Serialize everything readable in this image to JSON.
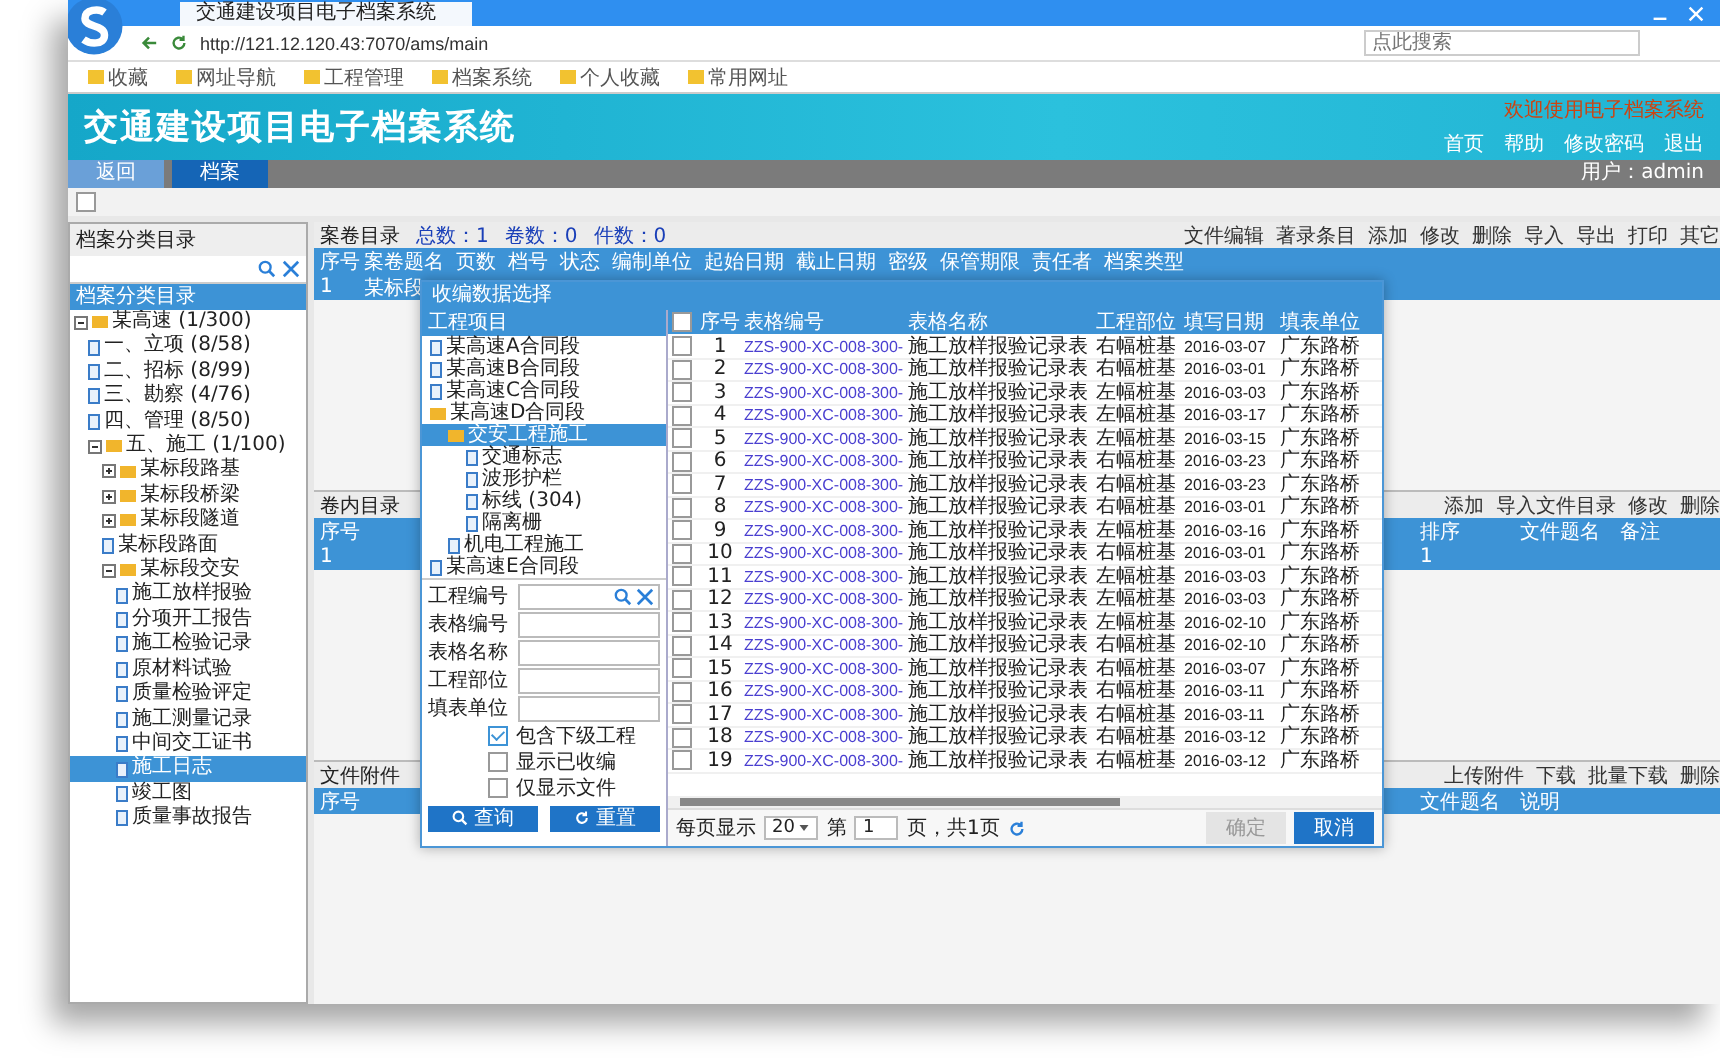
{
  "browser": {
    "tab_title": "交通建设项目电子档案系统",
    "url": "http://121.12.120.43:7070/ams/main",
    "search_placeholder": "点此搜索",
    "bookmarks": [
      "收藏",
      "网址导航",
      "工程管理",
      "档案系统",
      "个人收藏",
      "常用网址"
    ]
  },
  "header": {
    "title": "交通建设项目电子档案系统",
    "notice": "欢迎使用电子档案系统",
    "links": [
      "首页",
      "帮助",
      "修改密码",
      "退出"
    ]
  },
  "tabs": [
    {
      "label": "返回",
      "selected": false
    },
    {
      "label": "档案",
      "selected": true
    }
  ],
  "user": "用户：admin",
  "toolbar_checkbox": {
    "checked": false
  },
  "tree_panel": {
    "title": "档案分类目录",
    "header": "档案分类目录",
    "items": [
      {
        "label": "某高速 (1/300)",
        "selected": false,
        "expanded": true,
        "children": [
          {
            "label": "一、立项 (8/58)",
            "selected": false
          },
          {
            "label": "二、招标 (8/99)",
            "selected": false
          },
          {
            "label": "三、勘察 (4/76)",
            "selected": false
          },
          {
            "label": "四、管理 (8/50)",
            "selected": false
          },
          {
            "label": "五、施工 (1/100)",
            "selected": false,
            "expanded": true,
            "children": [
              {
                "label": "某标段路基",
                "selected": false,
                "expanded": false
              },
              {
                "label": "某标段桥梁",
                "selected": false,
                "expanded": false
              },
              {
                "label": "某标段隧道",
                "selected": false,
                "expanded": false
              },
              {
                "label": "某标段路面",
                "selected": false
              },
              {
                "label": "某标段交安",
                "selected": false,
                "expanded": true,
                "children": [
                  {
                    "label": "施工放样报验",
                    "selected": false
                  },
                  {
                    "label": "分项开工报告",
                    "selected": false
                  },
                  {
                    "label": "施工检验记录",
                    "selected": false
                  },
                  {
                    "label": "原材料试验",
                    "selected": false
                  },
                  {
                    "label": "质量检验评定",
                    "selected": false
                  },
                  {
                    "label": "施工测量记录",
                    "selected": false
                  },
                  {
                    "label": "中间交工证书",
                    "selected": false
                  },
                  {
                    "label": "施工日志",
                    "selected": true
                  },
                  {
                    "label": "竣工图",
                    "selected": false
                  },
                  {
                    "label": "质量事故报告",
                    "selected": false
                  }
                ]
              }
            ]
          }
        ]
      }
    ]
  },
  "main_grid": {
    "title": "案卷目录",
    "counts": [
      "总数：1",
      "卷数：0",
      "件数：0"
    ],
    "toolbar": [
      "文件编辑",
      "著录条目",
      "添加",
      "修改",
      "删除",
      "导入",
      "导出",
      "打印",
      "其它"
    ],
    "columns": [
      "序号",
      "案卷题名",
      "页数",
      "档号",
      "状态",
      "编制单位",
      "起始日期",
      "截止日期",
      "密级",
      "保管期限",
      "责任者",
      "档案类型"
    ],
    "rows": [
      {
        "index": "1",
        "title": "某标段"
      }
    ]
  },
  "inner_grid": {
    "title": "卷内目录",
    "toolbar": [
      "添加",
      "导入文件目录",
      "修改",
      "删除"
    ],
    "columns": [
      "序号",
      "排序",
      "文件题名",
      "备注"
    ],
    "rows": [
      {
        "index": "1",
        "order": "1"
      }
    ]
  },
  "attach_grid": {
    "title": "文件附件",
    "toolbar": [
      "上传附件",
      "下载",
      "批量下载",
      "删除"
    ],
    "columns": [
      "序号",
      "文件题名",
      "说明"
    ]
  },
  "dialog": {
    "title": "收编数据选择",
    "tree_header": "工程项目",
    "tree": [
      {
        "label": "某高速A合同段",
        "selected": false,
        "kind": "file"
      },
      {
        "label": "某高速B合同段",
        "selected": false,
        "kind": "file"
      },
      {
        "label": "某高速C合同段",
        "selected": false,
        "kind": "file"
      },
      {
        "label": "某高速D合同段",
        "selected": false,
        "kind": "folder",
        "children": [
          {
            "label": "交安工程施工",
            "selected": true,
            "kind": "folder",
            "children": [
              {
                "label": "交通标志",
                "selected": false,
                "kind": "file"
              },
              {
                "label": "波形护栏",
                "selected": false,
                "kind": "file"
              },
              {
                "label": "标线 (304)",
                "selected": false,
                "kind": "file"
              },
              {
                "label": "隔离栅",
                "selected": false,
                "kind": "file"
              }
            ]
          },
          {
            "label": "机电工程施工",
            "selected": false,
            "kind": "file"
          }
        ]
      },
      {
        "label": "某高速E合同段",
        "selected": false,
        "kind": "file"
      }
    ],
    "fields": [
      {
        "label": "工程编号",
        "kind": "search"
      },
      {
        "label": "表格编号",
        "kind": "text"
      },
      {
        "label": "表格名称",
        "kind": "text"
      },
      {
        "label": "工程部位",
        "kind": "text"
      },
      {
        "label": "填表单位",
        "kind": "text"
      }
    ],
    "options": [
      {
        "label": "包含下级工程",
        "checked": true
      },
      {
        "label": "显示已收编",
        "checked": false
      },
      {
        "label": "仅显示文件",
        "checked": false
      }
    ],
    "buttons": [
      {
        "label": "查询",
        "kind": "search"
      },
      {
        "label": "重置",
        "kind": "reset"
      }
    ],
    "select_all": {
      "checked": false
    },
    "columns": [
      "序号",
      "表格编号",
      "表格名称",
      "工程部位",
      "填写日期",
      "填表单位"
    ],
    "rows": [
      {
        "checked": false,
        "n": "1",
        "code": "ZZS-900-XC-008-300-",
        "name": "施工放样报验记录表",
        "part": "右幅桩基",
        "date": "2016-03-07",
        "unit": "广东路桥"
      },
      {
        "checked": false,
        "n": "2",
        "code": "ZZS-900-XC-008-300-",
        "name": "施工放样报验记录表",
        "part": "右幅桩基",
        "date": "2016-03-01",
        "unit": "广东路桥"
      },
      {
        "checked": false,
        "n": "3",
        "code": "ZZS-900-XC-008-300-",
        "name": "施工放样报验记录表",
        "part": "左幅桩基",
        "date": "2016-03-03",
        "unit": "广东路桥"
      },
      {
        "checked": false,
        "n": "4",
        "code": "ZZS-900-XC-008-300-",
        "name": "施工放样报验记录表",
        "part": "左幅桩基",
        "date": "2016-03-17",
        "unit": "广东路桥"
      },
      {
        "checked": false,
        "n": "5",
        "code": "ZZS-900-XC-008-300-",
        "name": "施工放样报验记录表",
        "part": "左幅桩基",
        "date": "2016-03-15",
        "unit": "广东路桥"
      },
      {
        "checked": false,
        "n": "6",
        "code": "ZZS-900-XC-008-300-",
        "name": "施工放样报验记录表",
        "part": "右幅桩基",
        "date": "2016-03-23",
        "unit": "广东路桥"
      },
      {
        "checked": false,
        "n": "7",
        "code": "ZZS-900-XC-008-300-",
        "name": "施工放样报验记录表",
        "part": "右幅桩基",
        "date": "2016-03-23",
        "unit": "广东路桥"
      },
      {
        "checked": false,
        "n": "8",
        "code": "ZZS-900-XC-008-300-",
        "name": "施工放样报验记录表",
        "part": "右幅桩基",
        "date": "2016-03-01",
        "unit": "广东路桥"
      },
      {
        "checked": false,
        "n": "9",
        "code": "ZZS-900-XC-008-300-",
        "name": "施工放样报验记录表",
        "part": "左幅桩基",
        "date": "2016-03-16",
        "unit": "广东路桥"
      },
      {
        "checked": false,
        "n": "10",
        "code": "ZZS-900-XC-008-300-",
        "name": "施工放样报验记录表",
        "part": "右幅桩基",
        "date": "2016-03-01",
        "unit": "广东路桥"
      },
      {
        "checked": false,
        "n": "11",
        "code": "ZZS-900-XC-008-300-",
        "name": "施工放样报验记录表",
        "part": "左幅桩基",
        "date": "2016-03-03",
        "unit": "广东路桥"
      },
      {
        "checked": false,
        "n": "12",
        "code": "ZZS-900-XC-008-300-",
        "name": "施工放样报验记录表",
        "part": "左幅桩基",
        "date": "2016-03-03",
        "unit": "广东路桥"
      },
      {
        "checked": false,
        "n": "13",
        "code": "ZZS-900-XC-008-300-",
        "name": "施工放样报验记录表",
        "part": "左幅桩基",
        "date": "2016-02-10",
        "unit": "广东路桥"
      },
      {
        "checked": false,
        "n": "14",
        "code": "ZZS-900-XC-008-300-",
        "name": "施工放样报验记录表",
        "part": "右幅桩基",
        "date": "2016-02-10",
        "unit": "广东路桥"
      },
      {
        "checked": false,
        "n": "15",
        "code": "ZZS-900-XC-008-300-",
        "name": "施工放样报验记录表",
        "part": "右幅桩基",
        "date": "2016-03-07",
        "unit": "广东路桥"
      },
      {
        "checked": false,
        "n": "16",
        "code": "ZZS-900-XC-008-300-",
        "name": "施工放样报验记录表",
        "part": "右幅桩基",
        "date": "2016-03-11",
        "unit": "广东路桥"
      },
      {
        "checked": false,
        "n": "17",
        "code": "ZZS-900-XC-008-300-",
        "name": "施工放样报验记录表",
        "part": "右幅桩基",
        "date": "2016-03-11",
        "unit": "广东路桥"
      },
      {
        "checked": false,
        "n": "18",
        "code": "ZZS-900-XC-008-300-",
        "name": "施工放样报验记录表",
        "part": "右幅桩基",
        "date": "2016-03-12",
        "unit": "广东路桥"
      },
      {
        "checked": false,
        "n": "19",
        "code": "ZZS-900-XC-008-300-",
        "name": "施工放样报验记录表",
        "part": "右幅桩基",
        "date": "2016-03-12",
        "unit": "广东路桥"
      }
    ],
    "pager": {
      "label": "每页显示",
      "size": "20",
      "page_prefix": "第",
      "page": "1",
      "page_suffix": "页，共1页"
    },
    "actions": [
      {
        "label": "确定",
        "disabled": true
      },
      {
        "label": "取消",
        "disabled": false
      }
    ]
  }
}
